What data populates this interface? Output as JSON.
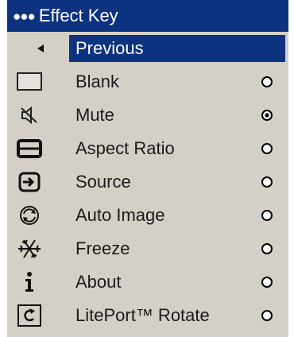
{
  "menu": {
    "title": "Effect Key",
    "dots": "●●●",
    "previous": {
      "label": "Previous",
      "icon": "back-arrow-icon"
    },
    "items": [
      {
        "label": "Blank",
        "icon": "blank-screen-icon",
        "selected": false
      },
      {
        "label": "Mute",
        "icon": "mute-speaker-icon",
        "selected": true
      },
      {
        "label": "Aspect Ratio",
        "icon": "aspect-ratio-icon",
        "selected": false
      },
      {
        "label": "Source",
        "icon": "source-input-icon",
        "selected": false
      },
      {
        "label": "Auto Image",
        "icon": "auto-image-icon",
        "selected": false
      },
      {
        "label": "Freeze",
        "icon": "freeze-snowflake-icon",
        "selected": false
      },
      {
        "label": "About",
        "icon": "info-icon",
        "selected": false
      },
      {
        "label": "LitePort™ Rotate",
        "icon": "rotate-icon",
        "selected": false
      }
    ]
  },
  "colors": {
    "panel": "#d4d0c8",
    "accent": "#0c3280",
    "text": "#1a1a1a"
  }
}
